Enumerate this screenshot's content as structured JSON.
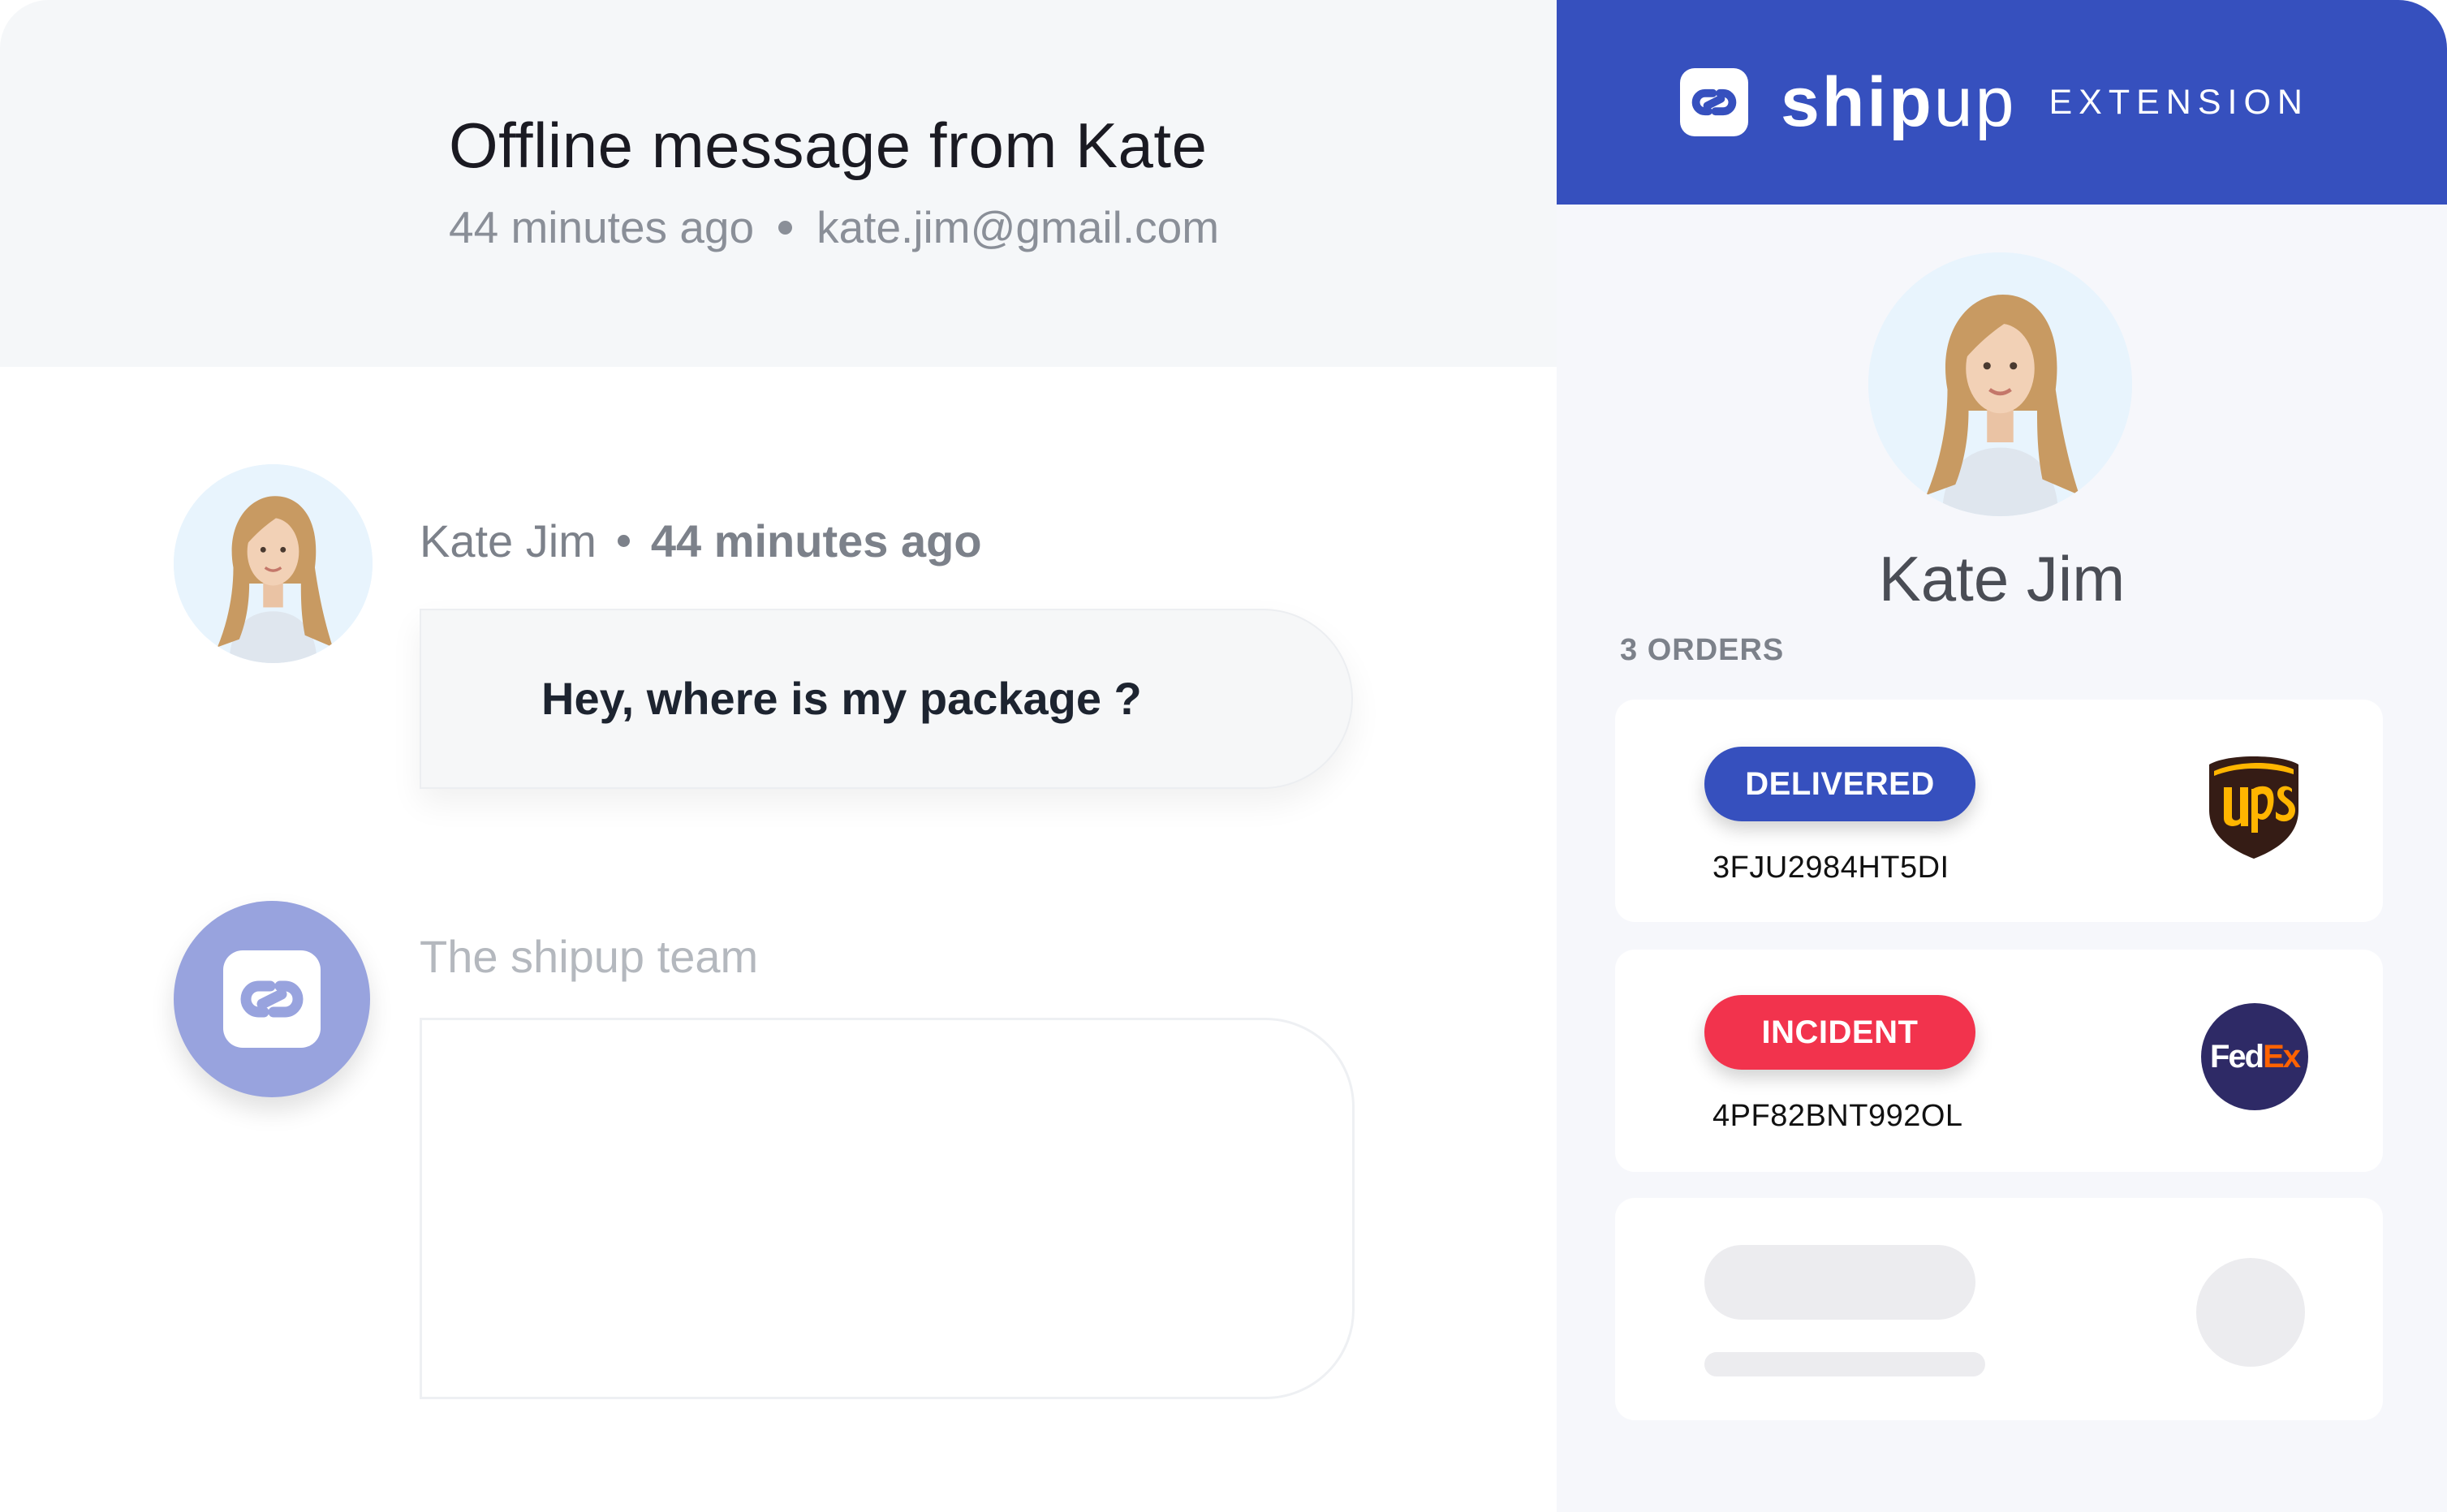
{
  "conversation": {
    "title": "Offline message from Kate",
    "time_ago": "44 minutes ago",
    "email": "kate.jim@gmail.com"
  },
  "message": {
    "author": "Kate Jim",
    "time_ago": "44 minutes ago",
    "text": "Hey, where is my package ?"
  },
  "reply": {
    "team_name": "The shipup team",
    "value": ""
  },
  "extension": {
    "brand_bold": "ship",
    "brand_light": "up",
    "label": "EXTENSION",
    "header_color": "#3650be"
  },
  "customer": {
    "name": "Kate Jim",
    "orders_label": "3  ORDERS"
  },
  "orders": [
    {
      "status": "DELIVERED",
      "status_color": "#3650be",
      "tracking": "3FJU2984HT5DI",
      "carrier": "ups",
      "carrier_icon": "ups-logo-icon"
    },
    {
      "status": "INCIDENT",
      "status_color": "#f2334d",
      "tracking": "4PF82BNT992OL",
      "carrier": "fedex",
      "carrier_icon": "fedex-logo-icon",
      "carrier_text_fed": "Fed",
      "carrier_text_ex": "Ex"
    },
    {
      "status": "",
      "tracking": "",
      "carrier": "",
      "loading": true
    }
  ],
  "colors": {
    "accent": "#3650be",
    "incident": "#f2334d",
    "team_avatar": "#98a3de"
  }
}
